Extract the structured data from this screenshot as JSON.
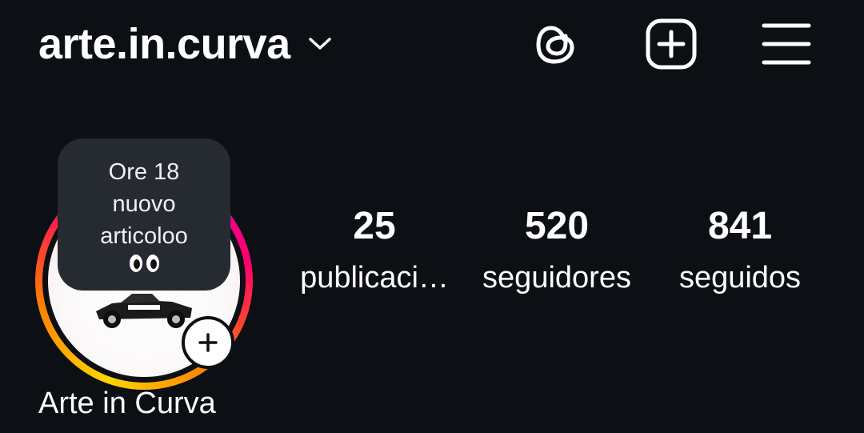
{
  "header": {
    "username": "arte.in.curva",
    "icons": [
      "chevron-down-icon",
      "threads-icon",
      "create-post-icon",
      "menu-icon"
    ]
  },
  "profile": {
    "display_name": "Arte in Curva",
    "note": {
      "lines": [
        "Ore 18",
        "nuovo",
        "articoloo"
      ],
      "emoji": "eyes"
    }
  },
  "stats": {
    "posts": {
      "value": "25",
      "label": "publicaci…"
    },
    "followers": {
      "value": "520",
      "label": "seguidores"
    },
    "following": {
      "value": "841",
      "label": "seguidos"
    }
  },
  "colors": {
    "background": "#0c0f14",
    "note_bubble": "#262a31",
    "story_ring": [
      "#ffd600",
      "#ff7a00",
      "#ff0069",
      "#d300c5"
    ]
  }
}
